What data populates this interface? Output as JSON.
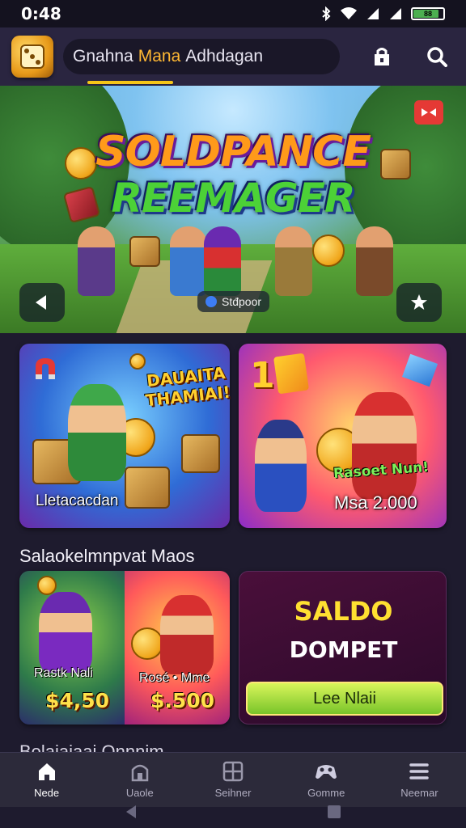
{
  "status_bar": {
    "time": "0:48",
    "battery_text": "88"
  },
  "header": {
    "search_text_a": "Gnahna",
    "search_text_highlight": "Mana",
    "search_text_b": "Adhdagan"
  },
  "hero": {
    "title_line1": "SOLDPANCE",
    "title_line2": "REEMAGER",
    "chip_label": "Stđpoor"
  },
  "promo_cards": [
    {
      "tag": "DAUAITA THAMIAI!",
      "caption": "Lletacacdan"
    },
    {
      "tag": "Rasoet Nun!",
      "caption": "Msa 2.000"
    }
  ],
  "section": {
    "heading": "Salaokelmnpvat Maos"
  },
  "deal_card": {
    "name_a": "Rastk Nali",
    "price_a": "$4,50",
    "name_b": "Rosé • Mme",
    "price_b": "$.500"
  },
  "saldo_card": {
    "line1": "SALDO",
    "line2": "DOMPET",
    "button_label": "Lee Nlaii"
  },
  "next_section": {
    "heading": "Bolaiaiaai Onnnim"
  },
  "nav": {
    "items": [
      {
        "label": "Nede",
        "icon": "home-icon",
        "active": true
      },
      {
        "label": "Uaole",
        "icon": "store-icon",
        "active": false
      },
      {
        "label": "Seihner",
        "icon": "grid-icon",
        "active": false
      },
      {
        "label": "Gomme",
        "icon": "gamepad-icon",
        "active": false
      },
      {
        "label": "Neemar",
        "icon": "menu-icon",
        "active": false
      }
    ]
  },
  "colors": {
    "accent": "#f5c518",
    "background": "#1e1b2e",
    "cta": "#78c42a"
  }
}
